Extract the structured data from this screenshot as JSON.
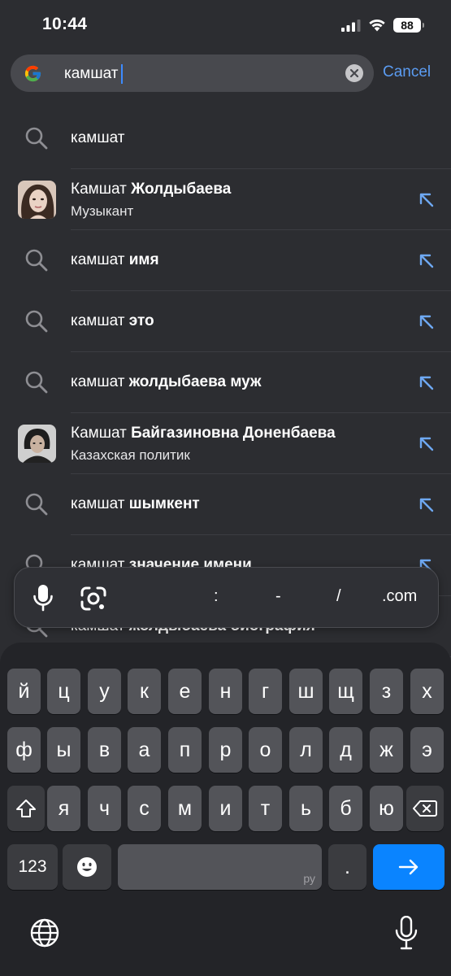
{
  "status_bar": {
    "time": "10:44",
    "battery": "88"
  },
  "search": {
    "value": "камшат",
    "cancel_label": "Cancel"
  },
  "suggestions": [
    {
      "type": "query",
      "prefix": "камшат",
      "bold": ""
    },
    {
      "type": "entity",
      "prefix": "Камшат",
      "bold": "Жолдыбаева",
      "subtitle": "Музыкант"
    },
    {
      "type": "query",
      "prefix": "камшат",
      "bold": "имя"
    },
    {
      "type": "query",
      "prefix": "камшат",
      "bold": "это"
    },
    {
      "type": "query",
      "prefix": "камшат",
      "bold": "жолдыбаева муж"
    },
    {
      "type": "entity",
      "prefix": "Камшат",
      "bold": "Байгазиновна Доненбаева",
      "subtitle": "Казахская политик"
    },
    {
      "type": "query",
      "prefix": "камшат",
      "bold": "шымкент"
    },
    {
      "type": "query",
      "prefix": "камшат",
      "bold": "значение имени"
    },
    {
      "type": "query",
      "prefix": "камшат",
      "bold": "жолдыбаева биография"
    }
  ],
  "accessory_bar": {
    "keys": [
      ":",
      "-",
      "/",
      ".com"
    ]
  },
  "keyboard": {
    "row1": [
      "й",
      "ц",
      "у",
      "к",
      "е",
      "н",
      "г",
      "ш",
      "щ",
      "з",
      "х"
    ],
    "row2": [
      "ф",
      "ы",
      "в",
      "а",
      "п",
      "р",
      "о",
      "л",
      "д",
      "ж",
      "э"
    ],
    "row3": [
      "я",
      "ч",
      "с",
      "м",
      "и",
      "т",
      "ь",
      "б",
      "ю"
    ],
    "numbers_label": "123",
    "period_label": ".",
    "space_lang": "ру"
  },
  "colors": {
    "accent": "#0a84ff",
    "link": "#5b9cf2",
    "background": "#2c2d31"
  }
}
